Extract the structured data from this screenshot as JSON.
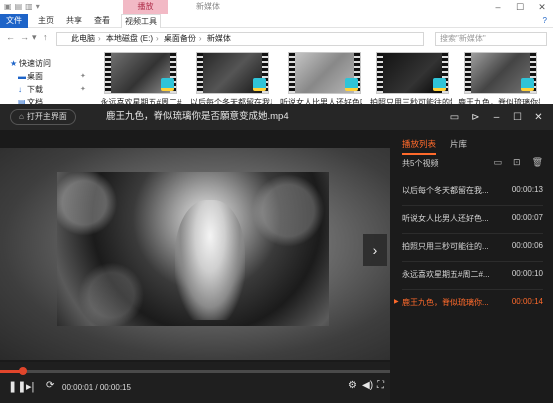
{
  "explorer": {
    "context_tab": "播放",
    "window_title": "新媒体",
    "ribbon_tabs": [
      "文件",
      "主页",
      "共享",
      "查看",
      "视频工具"
    ],
    "path": [
      "此电脑",
      "本地磁盘 (E:)",
      "桌面备份",
      "新媒体"
    ],
    "search_placeholder": "搜索\"新媒体\"",
    "nav": [
      {
        "label": "快速访问",
        "icon": "star-icon"
      },
      {
        "label": "桌面",
        "icon": "desktop-icon"
      },
      {
        "label": "下载",
        "icon": "download-icon"
      },
      {
        "label": "文档",
        "icon": "document-icon"
      }
    ],
    "files": [
      "永远喜欢星期五#周二#",
      "以后每个冬天都留在我身",
      "听说女人比男人还好色吗",
      "拍照只用三秒可能往的解",
      "鹿王九色，脊似琉璃你是"
    ]
  },
  "player": {
    "home_button": "打开主界面",
    "title": "鹿王九色，脊似琉璃你是否願意变成她.mp4",
    "current_time": "00:00:01",
    "total_time": "00:00:15",
    "progress": 0.06,
    "tabs": [
      "播放列表",
      "片库"
    ],
    "playlist_count": "共5个视频",
    "playlist": [
      {
        "name": "以后每个冬天都留在我...",
        "duration": "00:00:13"
      },
      {
        "name": "听说女人比男人还好色...",
        "duration": "00:00:07"
      },
      {
        "name": "拍照只用三秒可能往的...",
        "duration": "00:00:06"
      },
      {
        "name": "永远喜欢星期五#周二#...",
        "duration": "00:00:10"
      },
      {
        "name": "鹿王九色，脊似琉璃你...",
        "duration": "00:00:14",
        "playing": true
      }
    ],
    "accent_color": "#ff6a2b"
  }
}
